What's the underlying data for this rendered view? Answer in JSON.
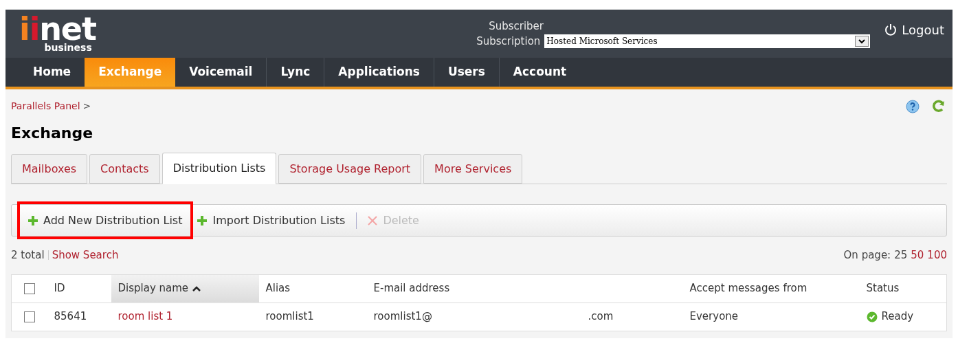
{
  "header": {
    "logo": {
      "mark_orange": "i",
      "mark_red": "i",
      "word": "net",
      "sub": "business"
    },
    "subscriber_label": "Subscriber",
    "subscription_label": "Subscription",
    "subscription_value": "Hosted Microsoft Services",
    "logout": "Logout"
  },
  "nav": [
    {
      "label": "Home",
      "selected": false
    },
    {
      "label": "Exchange",
      "selected": true
    },
    {
      "label": "Voicemail",
      "selected": false
    },
    {
      "label": "Lync",
      "selected": false
    },
    {
      "label": "Applications",
      "selected": false
    },
    {
      "label": "Users",
      "selected": false
    },
    {
      "label": "Account",
      "selected": false
    }
  ],
  "breadcrumb": {
    "link": "Parallels Panel",
    "separator": ">"
  },
  "title": "Exchange",
  "tabs": [
    {
      "label": "Mailboxes",
      "selected": false
    },
    {
      "label": "Contacts",
      "selected": false
    },
    {
      "label": "Distribution Lists",
      "selected": true
    },
    {
      "label": "Storage Usage Report",
      "selected": false
    },
    {
      "label": "More Services",
      "selected": false
    }
  ],
  "toolbar": [
    {
      "kind": "add",
      "label": "Add New Distribution List",
      "disabled": false,
      "highlighted": true
    },
    {
      "kind": "add",
      "label": "Import Distribution Lists",
      "disabled": false,
      "highlighted": false
    },
    {
      "kind": "delete",
      "label": "Delete",
      "disabled": true,
      "highlighted": false
    }
  ],
  "summary": {
    "total": "2 total",
    "search_link": "Show Search",
    "per_page_label": "On page:",
    "per_page": [
      {
        "label": "25",
        "selected": true
      },
      {
        "label": "50",
        "selected": false
      },
      {
        "label": "100",
        "selected": false
      }
    ]
  },
  "table": {
    "select_all_checked": false,
    "columns": [
      {
        "label": "ID",
        "sorted": false
      },
      {
        "label": "Display name",
        "sorted": true
      },
      {
        "label": "Alias",
        "sorted": false
      },
      {
        "label": "E-mail address",
        "sorted": false
      },
      {
        "label": "Accept messages from",
        "sorted": false
      },
      {
        "label": "Status",
        "sorted": false
      }
    ],
    "rows": [
      {
        "checked": false,
        "id": "85641",
        "name": "room list 1",
        "alias": "roomlist1",
        "email_local": "roomlist1@",
        "email_domain": ".com",
        "accept": "Everyone",
        "status": "Ready"
      }
    ]
  }
}
